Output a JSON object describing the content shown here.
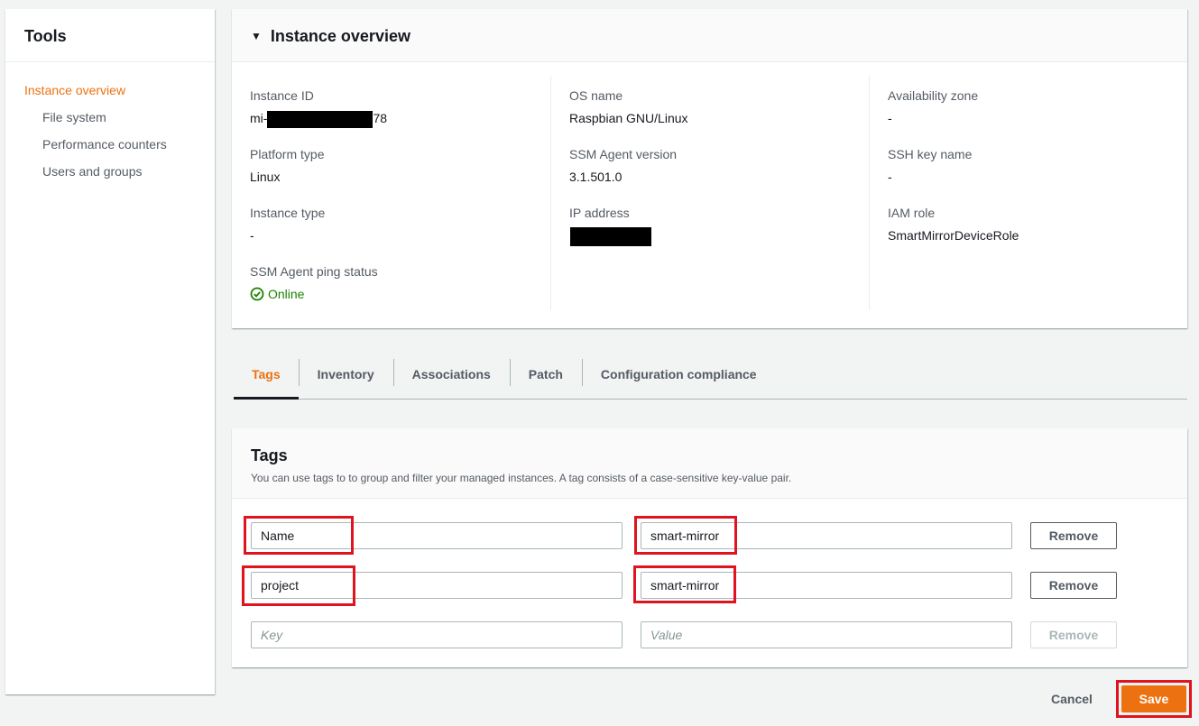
{
  "sidebar": {
    "title": "Tools",
    "items": [
      {
        "label": "Instance overview",
        "active": true
      },
      {
        "label": "File system",
        "active": false
      },
      {
        "label": "Performance counters",
        "active": false
      },
      {
        "label": "Users and groups",
        "active": false
      }
    ]
  },
  "overview": {
    "title": "Instance overview",
    "columns": [
      [
        {
          "label": "Instance ID",
          "value_prefix": "mi-",
          "value_suffix": "78"
        },
        {
          "label": "Platform type",
          "value": "Linux"
        },
        {
          "label": "Instance type",
          "value": "-"
        },
        {
          "label": "SSM Agent ping status",
          "value": "Online"
        }
      ],
      [
        {
          "label": "OS name",
          "value": "Raspbian GNU/Linux"
        },
        {
          "label": "SSM Agent version",
          "value": "3.1.501.0"
        },
        {
          "label": "IP address",
          "value": ""
        }
      ],
      [
        {
          "label": "Availability zone",
          "value": "-"
        },
        {
          "label": "SSH key name",
          "value": "-"
        },
        {
          "label": "IAM role",
          "value": "SmartMirrorDeviceRole"
        }
      ]
    ]
  },
  "tabs": [
    {
      "label": "Tags",
      "active": true
    },
    {
      "label": "Inventory",
      "active": false
    },
    {
      "label": "Associations",
      "active": false
    },
    {
      "label": "Patch",
      "active": false
    },
    {
      "label": "Configuration compliance",
      "active": false
    }
  ],
  "tags": {
    "title": "Tags",
    "description": "You can use tags to to group and filter your managed instances. A tag consists of a case-sensitive key-value pair.",
    "rows": [
      {
        "key": "Name",
        "value": "smart-mirror",
        "remove_label": "Remove"
      },
      {
        "key": "project",
        "value": "smart-mirror",
        "remove_label": "Remove"
      }
    ],
    "new_row": {
      "key_placeholder": "Key",
      "value_placeholder": "Value",
      "remove_label": "Remove"
    }
  },
  "actions": {
    "cancel_label": "Cancel",
    "save_label": "Save"
  },
  "colors": {
    "accent": "#ec7211",
    "online": "#1d8102",
    "highlight": "#e0141e"
  },
  "icons": {
    "caret": "caret-down-icon",
    "online": "check-circle-icon"
  }
}
